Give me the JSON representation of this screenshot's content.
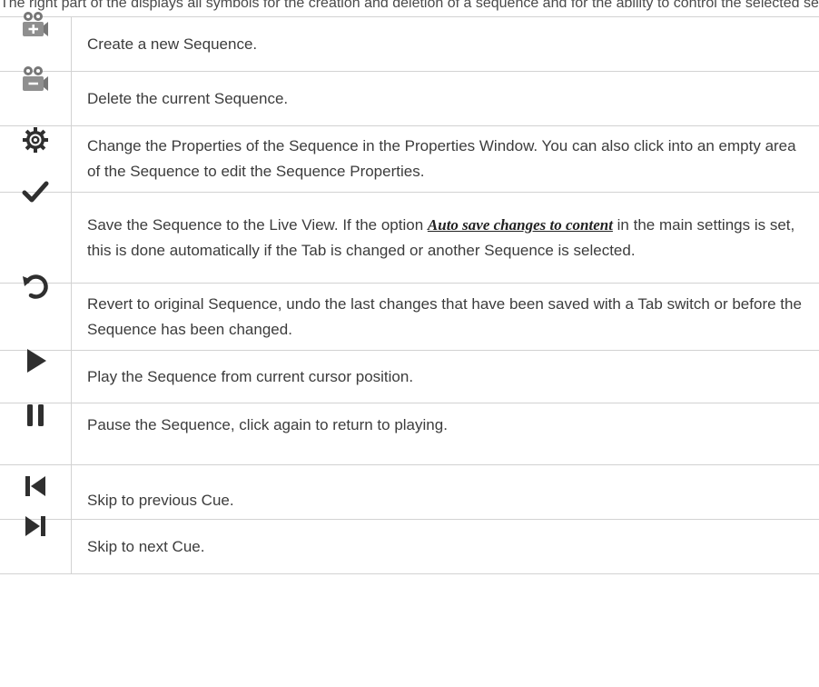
{
  "intro_text": "The right part of the displays all symbols for the creation and deletion of a sequence and for the ability to control the selected sequence.",
  "rows": [
    {
      "icon": "camera-plus-icon",
      "text": "Create a new Sequence."
    },
    {
      "icon": "camera-minus-icon",
      "text": "Delete the current Sequence."
    },
    {
      "icon": "gear-icon",
      "text": "Change the Properties of the Sequence in the Properties Window. You can also click into an empty area of the Sequence to edit the Sequence Properties."
    },
    {
      "icon": "checkmark-icon",
      "text_before": "Save the Sequence to the Live View. If the option ",
      "link": "Auto save changes to content",
      "text_after": " in the main settings is set, this is done automatically if the Tab is changed or another Sequence is selected."
    },
    {
      "icon": "revert-icon",
      "text": "Revert to original Sequence, undo the last changes that have been saved with a Tab switch or before the Sequence has been changed."
    },
    {
      "icon": "play-icon",
      "text": "Play the Sequence from current cursor position."
    },
    {
      "icon": "pause-icon",
      "text": "Pause the Sequence, click again to return to playing."
    },
    {
      "icon": "skip-previous-icon",
      "text": "Skip to previous Cue."
    },
    {
      "icon": "skip-next-icon",
      "text": "Skip to next Cue."
    }
  ],
  "colors": {
    "icon": "#2f2f2f",
    "icon_light": "#8a8a8a",
    "border": "#d2d2d2",
    "text": "#3c3c3c"
  }
}
